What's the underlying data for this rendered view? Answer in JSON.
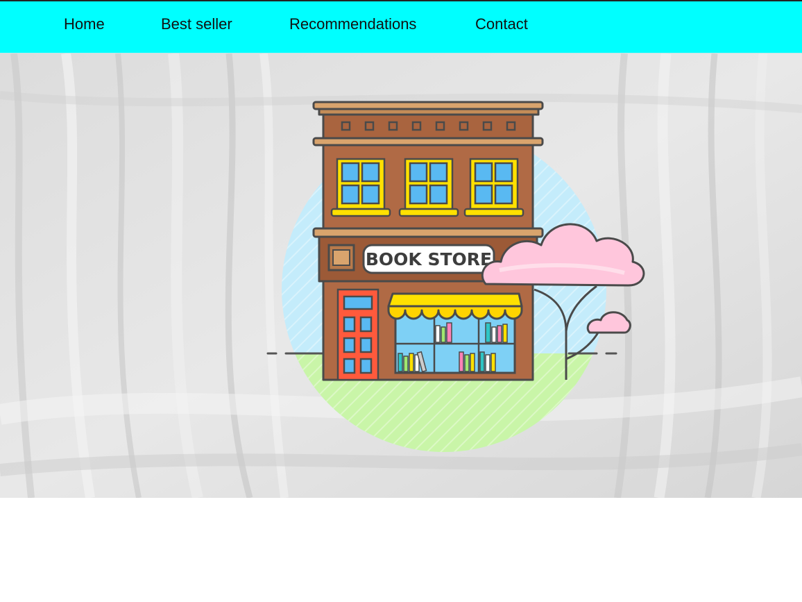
{
  "nav": {
    "links": [
      {
        "label": "Home"
      },
      {
        "label": "Best seller"
      },
      {
        "label": "Recommendations"
      },
      {
        "label": "Contact"
      }
    ]
  },
  "hero": {
    "illustration": "book-store-building",
    "sign_text": "BOOK STORE"
  },
  "colors": {
    "navbar": "#00ffff",
    "hero_texture": "#e4e4e4",
    "building": "#b06a45",
    "cloud": "#ffc6dc"
  }
}
